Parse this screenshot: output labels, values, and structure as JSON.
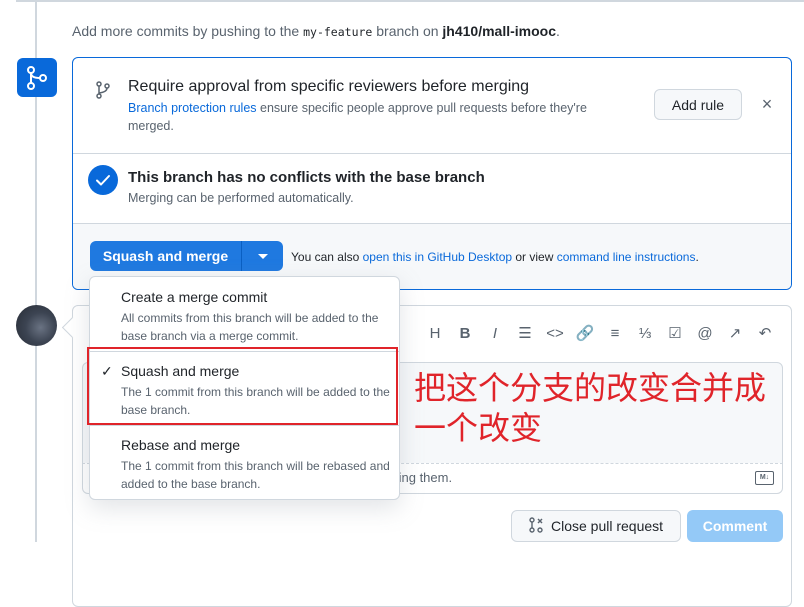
{
  "hint": {
    "prefix": "Add more commits by pushing to the ",
    "branch": "my-feature",
    "middle": " branch on ",
    "repo": "jh410/mall-imooc",
    "suffix": "."
  },
  "protection": {
    "title": "Require approval from specific reviewers before merging",
    "link": "Branch protection rules",
    "desc": " ensure specific people approve pull requests before they're merged.",
    "add_rule": "Add rule",
    "close": "×"
  },
  "conflicts": {
    "title": "This branch has no conflicts with the base branch",
    "desc": "Merging can be performed automatically."
  },
  "merge": {
    "button": "Squash and merge",
    "also_prefix": "You can also ",
    "desktop_link": "open this in GitHub Desktop",
    "also_middle": " or view ",
    "cli_link": "command line instructions",
    "also_suffix": "."
  },
  "dropdown": {
    "options": [
      {
        "title": "Create a merge commit",
        "desc": "All commits from this branch will be added to the base branch via a merge commit.",
        "selected": false
      },
      {
        "title": "Squash and merge",
        "desc": "The 1 commit from this branch will be added to the base branch.",
        "selected": true
      },
      {
        "title": "Rebase and merge",
        "desc": "The 1 commit from this branch will be rebased and added to the base branch.",
        "selected": false
      }
    ],
    "check": "✓"
  },
  "editor": {
    "attach_text": "ting them.",
    "md_label": "M↓"
  },
  "actions": {
    "close_pr": "Close pull request",
    "comment": "Comment"
  },
  "annotation": "把这个分支的改变合并成一个改变",
  "colors": {
    "accent": "#0969da",
    "button_blue": "#1f79e0",
    "annotation_red": "#e0242a"
  }
}
